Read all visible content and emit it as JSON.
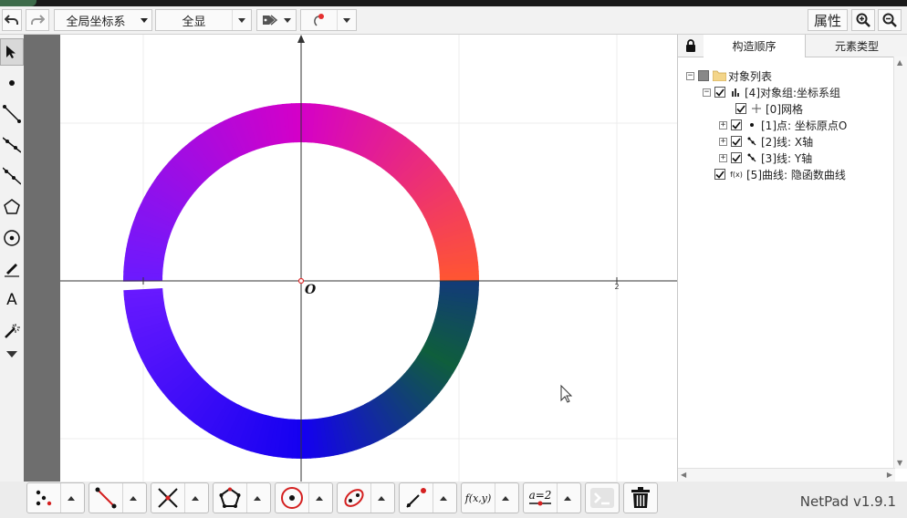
{
  "toolbar": {
    "coord_system": "全局坐标系",
    "view_mode": "全显",
    "properties_label": "属性"
  },
  "canvas": {
    "origin_label": "O",
    "x_tick_label": "2",
    "curve_gradient_colors": [
      "#ff5533",
      "#d400c8",
      "#6a1aff",
      "#1400f0",
      "#0f5e3c",
      "#123a7a"
    ]
  },
  "right_panel": {
    "tab_construct_order": "构造顺序",
    "tab_element_type": "元素类型",
    "tree": {
      "root_label": "对象列表",
      "items": [
        {
          "label": "[4]对象组:坐标系组",
          "icon": "group-icon"
        },
        {
          "label": "[0]网格",
          "icon": "grid-icon"
        },
        {
          "label": "[1]点: 坐标原点O",
          "icon": "point-icon"
        },
        {
          "label": "[2]线: X轴",
          "icon": "line-icon"
        },
        {
          "label": "[3]线: Y轴",
          "icon": "line-icon"
        },
        {
          "label": "[5]曲线: 隐函数曲线",
          "icon_text": "f(x)"
        }
      ]
    }
  },
  "bottom_bar": {
    "version": "NetPad v1.9.1",
    "function_label": "f(x,y)",
    "param_label": "a=2"
  }
}
